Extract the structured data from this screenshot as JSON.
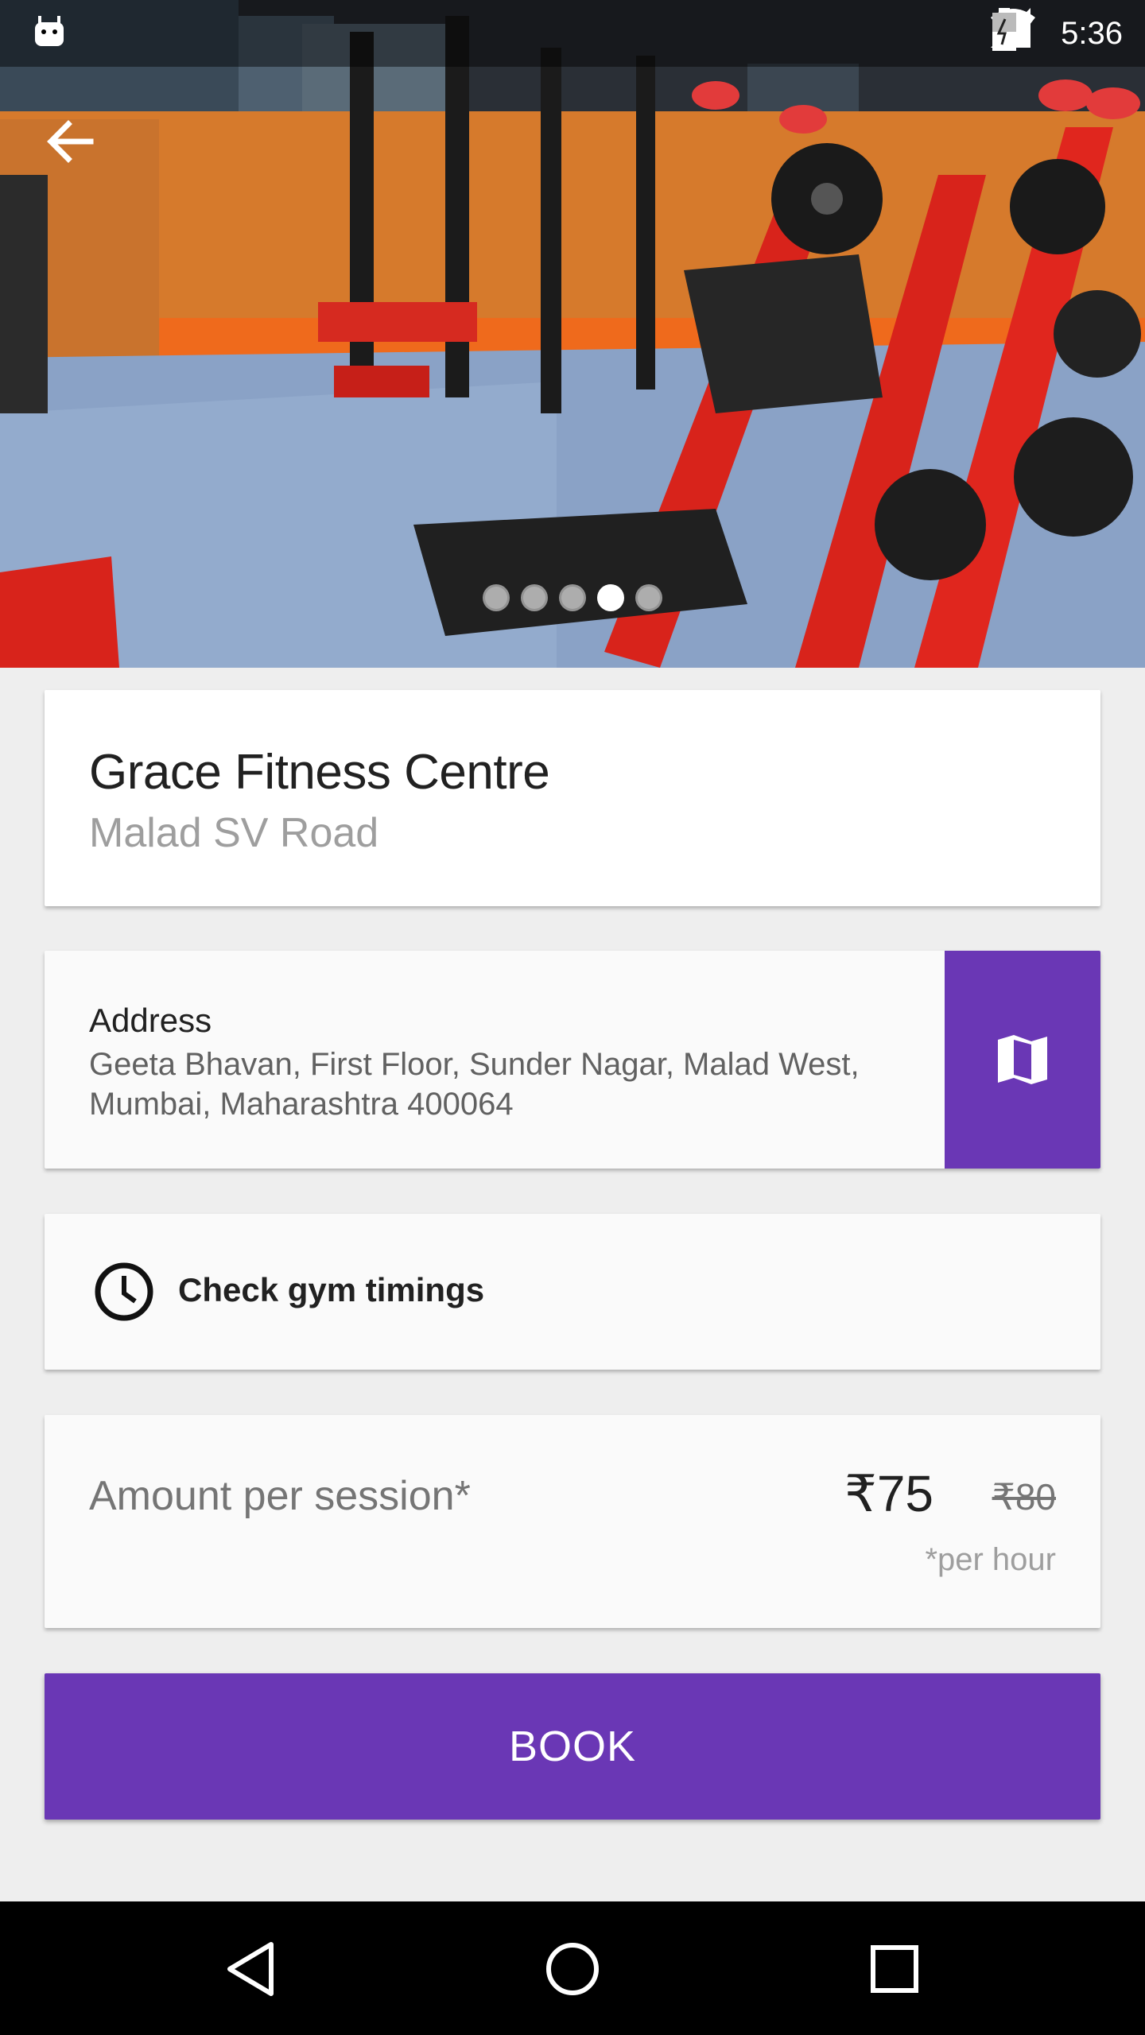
{
  "status_bar": {
    "time": "5:36"
  },
  "gallery": {
    "active_index": 3,
    "count": 5
  },
  "gym": {
    "name": "Grace Fitness Centre",
    "area": "Malad SV Road"
  },
  "address": {
    "label": "Address",
    "line1": "Geeta Bhavan, First Floor, Sunder Nagar, Malad West,",
    "line2": "Mumbai, Maharashtra 400064"
  },
  "timings": {
    "label": "Check gym timings"
  },
  "amount": {
    "label": "Amount per session*",
    "price": "₹75",
    "old_price": "₹80",
    "unit_note": "*per hour"
  },
  "book_button": {
    "label": "BOOK"
  },
  "colors": {
    "accent": "#6a37b5"
  }
}
